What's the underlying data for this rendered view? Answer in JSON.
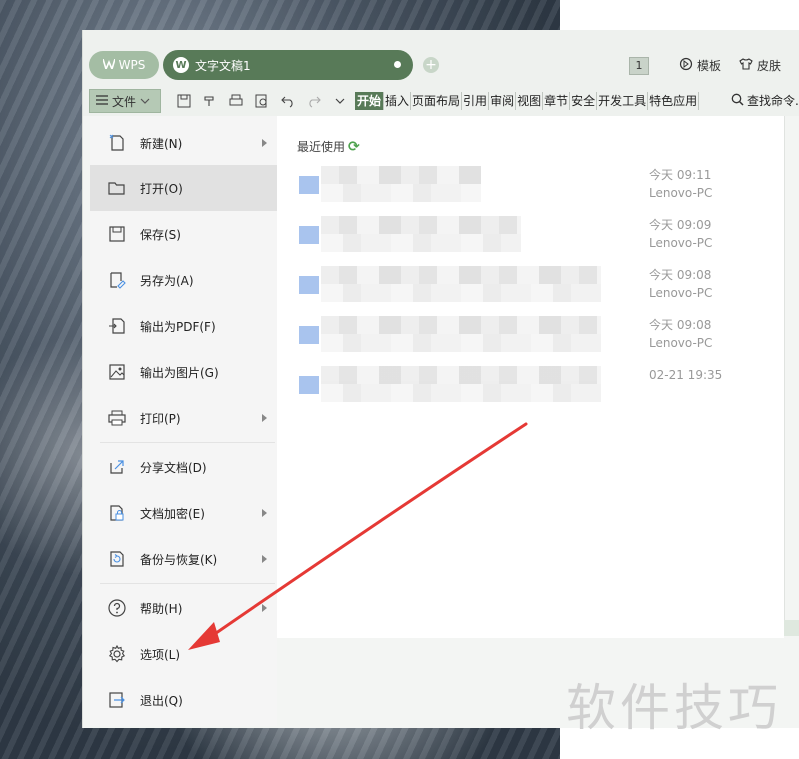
{
  "app": {
    "brand_label": "WPS",
    "document_tab_label": "文字文稿1",
    "doc_count_badge": "1",
    "template_label": "模板",
    "skin_label": "皮肤"
  },
  "toolbar": {
    "file_menu_label": "文件",
    "ribbon_tabs": [
      "开始",
      "插入",
      "页面布局",
      "引用",
      "审阅",
      "视图",
      "章节",
      "安全",
      "开发工具",
      "特色应用"
    ],
    "active_tab_index": 0,
    "search_label": "查找命令..."
  },
  "file_menu": {
    "items": [
      {
        "label": "新建(N)",
        "icon": "new-doc-icon",
        "has_submenu": true
      },
      {
        "label": "打开(O)",
        "icon": "folder-open-icon",
        "has_submenu": false,
        "highlighted": true
      },
      {
        "label": "保存(S)",
        "icon": "save-icon",
        "has_submenu": false
      },
      {
        "label": "另存为(A)",
        "icon": "save-as-icon",
        "has_submenu": false
      },
      {
        "label": "输出为PDF(F)",
        "icon": "export-pdf-icon",
        "has_submenu": false
      },
      {
        "label": "输出为图片(G)",
        "icon": "export-image-icon",
        "has_submenu": false
      },
      {
        "label": "打印(P)",
        "icon": "print-icon",
        "has_submenu": true
      },
      {
        "label": "分享文档(D)",
        "icon": "share-icon",
        "has_submenu": false
      },
      {
        "label": "文档加密(E)",
        "icon": "encrypt-icon",
        "has_submenu": true
      },
      {
        "label": "备份与恢复(K)",
        "icon": "backup-icon",
        "has_submenu": true
      },
      {
        "label": "帮助(H)",
        "icon": "help-icon",
        "has_submenu": true
      },
      {
        "label": "选项(L)",
        "icon": "gear-icon",
        "has_submenu": false
      },
      {
        "label": "退出(Q)",
        "icon": "exit-icon",
        "has_submenu": false
      }
    ]
  },
  "recent": {
    "title": "最近使用",
    "files": [
      {
        "time": "今天 09:11",
        "author": "Lenovo-PC"
      },
      {
        "time": "今天 09:09",
        "author": "Lenovo-PC"
      },
      {
        "time": "今天 09:08",
        "author": "Lenovo-PC"
      },
      {
        "time": "今天 09:08",
        "author": "Lenovo-PC"
      },
      {
        "time": "02-21 19:35",
        "author": ""
      }
    ]
  },
  "watermark": "软件技巧",
  "colors": {
    "accent_green": "#587a58",
    "annotation_red": "#e53935"
  }
}
